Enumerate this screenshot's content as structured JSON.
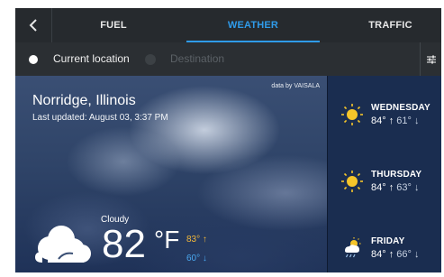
{
  "nav": {
    "back_icon": "back-chevron-icon",
    "tabs": [
      {
        "label": "FUEL",
        "active": false
      },
      {
        "label": "WEATHER",
        "active": true
      },
      {
        "label": "TRAFFIC",
        "active": false
      }
    ],
    "accent_color": "#2f9bea"
  },
  "location_bar": {
    "options": [
      {
        "label": "Current location",
        "selected": true
      },
      {
        "label": "Destination",
        "selected": false
      }
    ],
    "filter_icon": "sliders-icon"
  },
  "current": {
    "data_credit": "data by VAISALA",
    "city": "Norridge, Illinois",
    "last_updated": "Last updated: August 03, 3:37 PM",
    "condition": "Cloudy",
    "condition_icon": "cloud-icon",
    "temperature": "82",
    "unit": "°F",
    "high": "83° ↑",
    "low": "60° ↓",
    "high_color": "#f2b73a",
    "low_color": "#4aa8f0"
  },
  "forecast": [
    {
      "day": "WEDNESDAY",
      "high": "84° ↑",
      "low": "61° ↓",
      "icon": "sun-icon"
    },
    {
      "day": "THURSDAY",
      "high": "84° ↑",
      "low": "63° ↓",
      "icon": "sun-icon"
    },
    {
      "day": "FRIDAY",
      "high": "84° ↑",
      "low": "66° ↓",
      "icon": "rain-sun-icon"
    }
  ]
}
